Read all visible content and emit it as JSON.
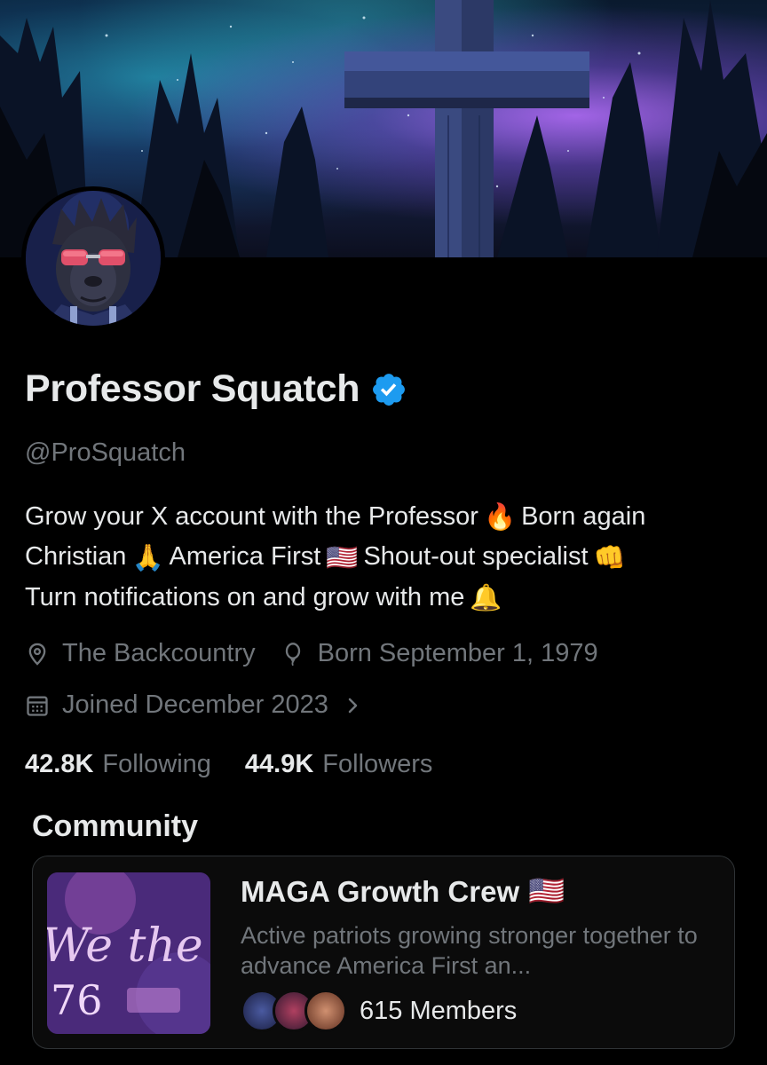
{
  "profile": {
    "name": "Professor Squatch",
    "handle": "@ProSquatch",
    "bio": {
      "line1a": "Grow your X account with the Professor",
      "line1b": "Born again",
      "line2a": "Christian",
      "line2b": "America First",
      "line2c": "Shout-out specialist",
      "line3a": "Turn notifications on and grow with me",
      "emoji_fire": "🔥",
      "emoji_pray": "🙏",
      "emoji_flag": "🇺🇸",
      "emoji_fist": "👊",
      "emoji_bell": "🔔"
    },
    "location": "The Backcountry",
    "birthday": "Born September 1, 1979",
    "joined": "Joined December 2023",
    "following_count": "42.8K",
    "following_label": "Following",
    "followers_count": "44.9K",
    "followers_label": "Followers"
  },
  "community": {
    "heading": "Community",
    "name": "MAGA Growth Crew",
    "name_emoji": "🇺🇸",
    "description": "Active patriots growing stronger together to advance America First an...",
    "members": "615 Members",
    "thumb_text": "We the Pe",
    "thumb_number": "76"
  },
  "colors": {
    "background": "#000000",
    "text_primary": "#e7e9ea",
    "text_secondary": "#71767b",
    "verified_blue": "#1d9bf0",
    "card_border": "#2f3336"
  },
  "icons": {
    "verified": "verified-badge-icon",
    "location": "location-pin-icon",
    "birthday": "balloon-icon",
    "joined": "calendar-icon",
    "chevron": "chevron-right-icon"
  }
}
